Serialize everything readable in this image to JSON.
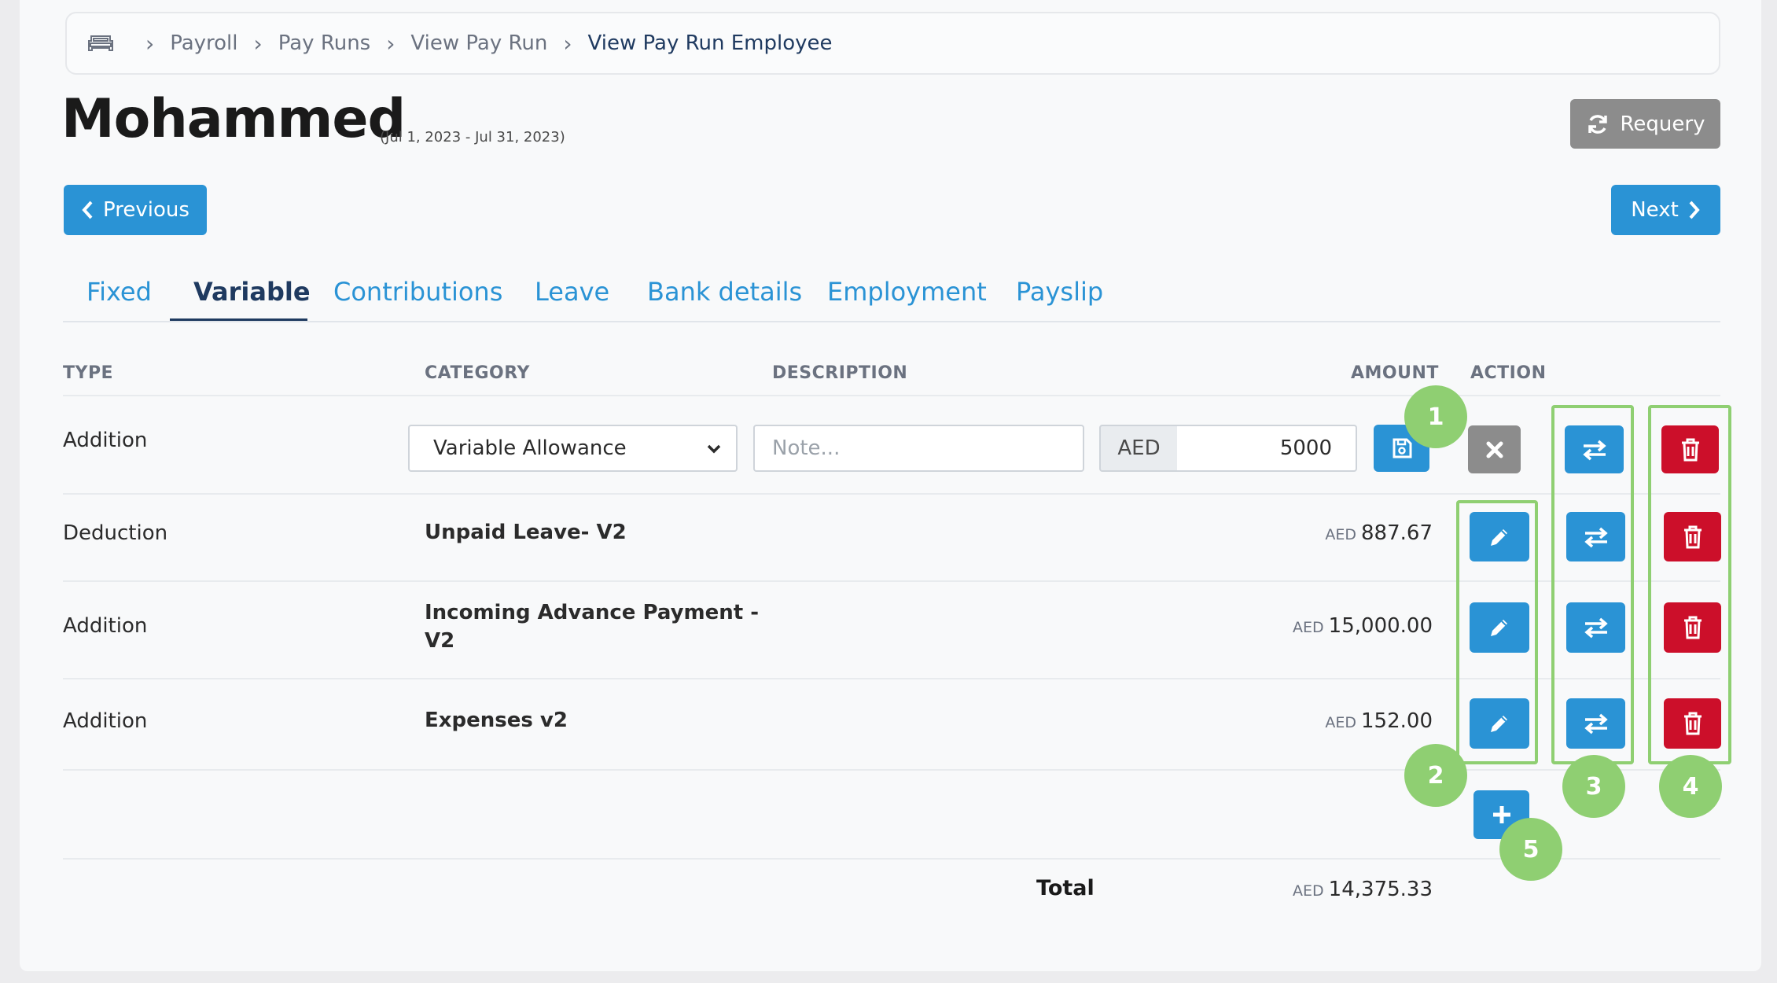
{
  "breadcrumb": {
    "items": [
      "Payroll",
      "Pay Runs",
      "View Pay Run"
    ],
    "current": "View Pay Run Employee"
  },
  "employee": {
    "name": "Mohammed",
    "period": "(Jul 1, 2023 - Jul 31, 2023)"
  },
  "buttons": {
    "requery": "Requery",
    "previous": "Previous",
    "next": "Next"
  },
  "tabs": [
    "Fixed",
    "Variable",
    "Contributions",
    "Leave",
    "Bank details",
    "Employment",
    "Payslip"
  ],
  "active_tab": "Variable",
  "table": {
    "headers": {
      "type": "TYPE",
      "category": "CATEGORY",
      "description": "DESCRIPTION",
      "amount": "AMOUNT",
      "action": "ACTION"
    },
    "edit_row": {
      "type": "Addition",
      "category": "Variable Allowance",
      "description_placeholder": "Note...",
      "currency": "AED",
      "amount": "5000"
    },
    "rows": [
      {
        "type": "Deduction",
        "category": "Unpaid Leave- V2",
        "currency": "AED",
        "amount": "887.67"
      },
      {
        "type": "Addition",
        "category_line1": "Incoming Advance Payment -",
        "category_line2": "V2",
        "currency": "AED",
        "amount": "15,000.00"
      },
      {
        "type": "Addition",
        "category": "Expenses v2",
        "currency": "AED",
        "amount": "152.00"
      }
    ],
    "total": {
      "label": "Total",
      "currency": "AED",
      "amount": "14,375.33"
    }
  },
  "annotations": [
    "1",
    "2",
    "3",
    "4",
    "5"
  ],
  "colors": {
    "primary": "#2a93d5",
    "danger": "#cc0f2a",
    "secondary": "#8c8c8c",
    "annotation": "#8fcf72",
    "heading": "#1f3a60"
  }
}
